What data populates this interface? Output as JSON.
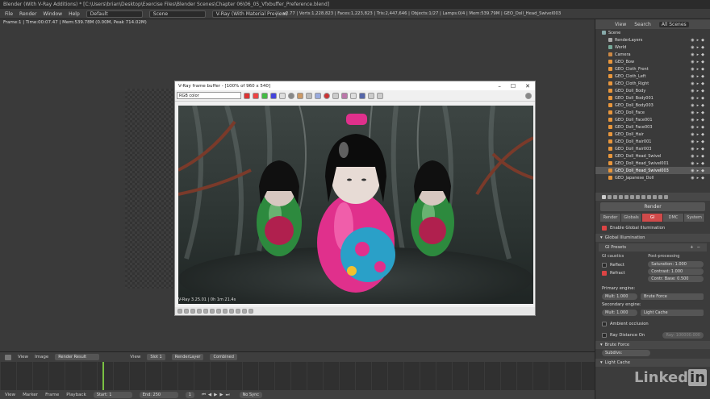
{
  "window": {
    "title": "Blender (With V-Ray Additions) * [C:\\Users\\brian\\Desktop\\Exercise Files\\Blender Scenes\\Chapter 06\\06_05_Vfxbuffer_Preference.blend]"
  },
  "topbar": {
    "menus": [
      "File",
      "Render",
      "Window",
      "Help"
    ],
    "layout": "Default",
    "scene": "Scene",
    "engine": "V-Ray (With Material Preview)",
    "stats": "v2.77 | Verts:1,228,823 | Faces:1,223,823 | Tris:2,447,646 | Objects:1/27 | Lamps:0/4 | Mem:539.79M | GEO_Doll_Head_Swivel003"
  },
  "viewport": {
    "info": "Frame:1 | Time:00:07.47 | Mem:539.78M (0.00M, Peak 714.02M)"
  },
  "vfb": {
    "title": "V-Ray frame buffer - [100% of 960 x 540]",
    "channel": "RGB color",
    "status": "V-Ray 3.25.01 | 0h 1m 21.4s"
  },
  "outliner": {
    "tabs": [
      "View",
      "Search",
      "All Scenes"
    ],
    "items": [
      {
        "label": "Scene",
        "indent": 0,
        "color": "#8aa"
      },
      {
        "label": "RenderLayers",
        "indent": 1,
        "color": "#aaa"
      },
      {
        "label": "World",
        "indent": 1,
        "color": "#7a9"
      },
      {
        "label": "Camera",
        "indent": 1,
        "color": "#c84"
      },
      {
        "label": "GEO_Bow",
        "indent": 1,
        "color": "#e8963c"
      },
      {
        "label": "GEO_Cloth_Front",
        "indent": 1,
        "color": "#e8963c"
      },
      {
        "label": "GEO_Cloth_Left",
        "indent": 1,
        "color": "#e8963c"
      },
      {
        "label": "GEO_Cloth_Right",
        "indent": 1,
        "color": "#e8963c"
      },
      {
        "label": "GEO_Doll_Body",
        "indent": 1,
        "color": "#e8963c"
      },
      {
        "label": "GEO_Doll_Body001",
        "indent": 1,
        "color": "#e8963c"
      },
      {
        "label": "GEO_Doll_Body003",
        "indent": 1,
        "color": "#e8963c"
      },
      {
        "label": "GEO_Doll_Face",
        "indent": 1,
        "color": "#e8963c"
      },
      {
        "label": "GEO_Doll_Face001",
        "indent": 1,
        "color": "#e8963c"
      },
      {
        "label": "GEO_Doll_Face003",
        "indent": 1,
        "color": "#e8963c"
      },
      {
        "label": "GEO_Doll_Hair",
        "indent": 1,
        "color": "#e8963c"
      },
      {
        "label": "GEO_Doll_Hair001",
        "indent": 1,
        "color": "#e8963c"
      },
      {
        "label": "GEO_Doll_Hair003",
        "indent": 1,
        "color": "#e8963c"
      },
      {
        "label": "GEO_Doll_Head_Swivel",
        "indent": 1,
        "color": "#e8963c"
      },
      {
        "label": "GEO_Doll_Head_Swivel001",
        "indent": 1,
        "color": "#e8963c"
      },
      {
        "label": "GEO_Doll_Head_Swivel003",
        "indent": 1,
        "color": "#e8963c",
        "selected": true
      },
      {
        "label": "GEO_Japanese_Doll",
        "indent": 1,
        "color": "#e8963c"
      }
    ]
  },
  "properties": {
    "context_label": "Render",
    "tabs": [
      "Render",
      "Globals",
      "GI",
      "DMC",
      "System"
    ],
    "active_tab": "GI",
    "enable_gi": "Enable Global Illumination",
    "section_gi": "Global Illumination",
    "gi_presets": "GI Presets",
    "gi_caustics": "GI caustics",
    "reflect": "Reflect",
    "refract": "Refract",
    "post_processing": "Post-processing",
    "saturation": "Saturation: 1.000",
    "contrast": "Contrast: 1.000",
    "contr_base": "Contr. Base: 0.500",
    "primary_engine": "Primary engine:",
    "primary_mult": "Mult: 1.000",
    "primary_type": "Brute Force",
    "secondary_engine": "Secondary engine:",
    "secondary_mult": "Mult: 1.000",
    "secondary_type": "Light Cache",
    "ambient_occlusion": "Ambient occlusion",
    "ray_distance": "Ray Distance On",
    "ray_value": "Ray: 100000.000",
    "section_brute": "Brute Force",
    "subdivs": "Subdivs:",
    "section_light_cache": "Light Cache"
  },
  "timeline": {
    "header": [
      "View",
      "Image",
      "Render Result",
      "View",
      "Slot 1",
      "RenderLayer",
      "Combined"
    ],
    "footer": [
      "View",
      "Marker",
      "Frame",
      "Playback"
    ],
    "start_label": "Start:",
    "start": "1",
    "end_label": "End:",
    "end": "250",
    "current": "1",
    "sync": "No Sync"
  },
  "brand": {
    "watermark": "Linked",
    "watermark_in": "in"
  },
  "colors": {
    "accent": "#d04a4a",
    "playhead": "#7ac142",
    "kimono_pink": "#e0308c",
    "kimono_green": "#3c9a4a"
  }
}
